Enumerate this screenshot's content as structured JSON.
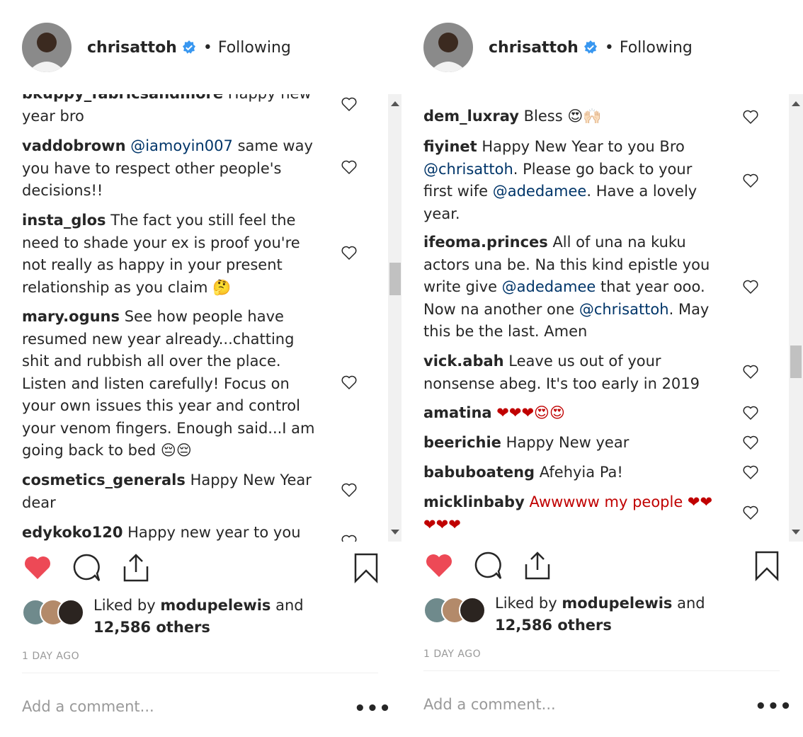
{
  "left": {
    "header": {
      "username": "chrisattoh",
      "separator": "•",
      "follow_status": "Following"
    },
    "comments": [
      {
        "user": "bkuppy_fabricsandmore",
        "text": " Happy new year bro"
      },
      {
        "user": "vaddobrown",
        "mention": "@iamoyin007",
        "text": " same way you have to respect other people's decisions!!"
      },
      {
        "user": "insta_glos",
        "text": " The fact you still feel the need to shade your ex is proof you're not really as happy in your present relationship as you claim 🤔"
      },
      {
        "user": "mary.oguns",
        "text": " See how people have resumed new year already...chatting shit and rubbish all over the place. Listen and listen carefully! Focus on your own issues this year and control your venom fingers. Enough said...I am going back to bed 😔😔"
      },
      {
        "user": "cosmetics_generals",
        "text": " Happy New Year dear"
      },
      {
        "user": "edykoko120",
        "text": " Happy new year to you"
      }
    ],
    "likes": {
      "prefix": "Liked by",
      "user": "modupelewis",
      "suffix": "and",
      "count": "12,586 others"
    },
    "timestamp": "1 DAY AGO",
    "add_comment_placeholder": "Add a comment...",
    "more": "•••"
  },
  "right": {
    "header": {
      "username": "chrisattoh",
      "separator": "•",
      "follow_status": "Following"
    },
    "comments": [
      {
        "user": "dem_luxray",
        "text": " Bless 😍🙌🏻"
      },
      {
        "user": "fiyinet",
        "text_a": " Happy New Year to you Bro ",
        "mention_a": "@chrisattoh",
        "text_b": ". Please go back to your first wife ",
        "mention_b": "@adedamee",
        "text_c": ". Have a lovely year."
      },
      {
        "user": "ifeoma.princes",
        "text_a": " All of una na kuku actors una be. Na this kind epistle you write give ",
        "mention_a": "@adedamee",
        "text_b": " that year ooo. Now na another one ",
        "mention_b": "@chrisattoh",
        "text_c": ". May this be the last. Amen"
      },
      {
        "user": "vick.abah",
        "text": " Leave us out of your nonsense abeg. It's too early in 2019"
      },
      {
        "user": "amatina",
        "text": " ❤❤❤😍😍"
      },
      {
        "user": "beerichie",
        "text": " Happy New year"
      },
      {
        "user": "babuboateng",
        "text": " Afehyia Pa!"
      },
      {
        "user": "micklinbaby",
        "text": " Awwwww my people ❤❤❤❤❤"
      }
    ],
    "likes": {
      "prefix": "Liked by",
      "user": "modupelewis",
      "suffix": "and",
      "count": "12,586 others"
    },
    "timestamp": "1 DAY AGO",
    "add_comment_placeholder": "Add a comment...",
    "more": "•••"
  },
  "colors": {
    "text": "#262626",
    "mention": "#003569",
    "like_red": "#ed4956",
    "verified_blue": "#3897f0",
    "muted": "#999999"
  },
  "icons": [
    "heart-icon",
    "comment-icon",
    "share-icon",
    "bookmark-icon",
    "verified-badge-icon"
  ]
}
